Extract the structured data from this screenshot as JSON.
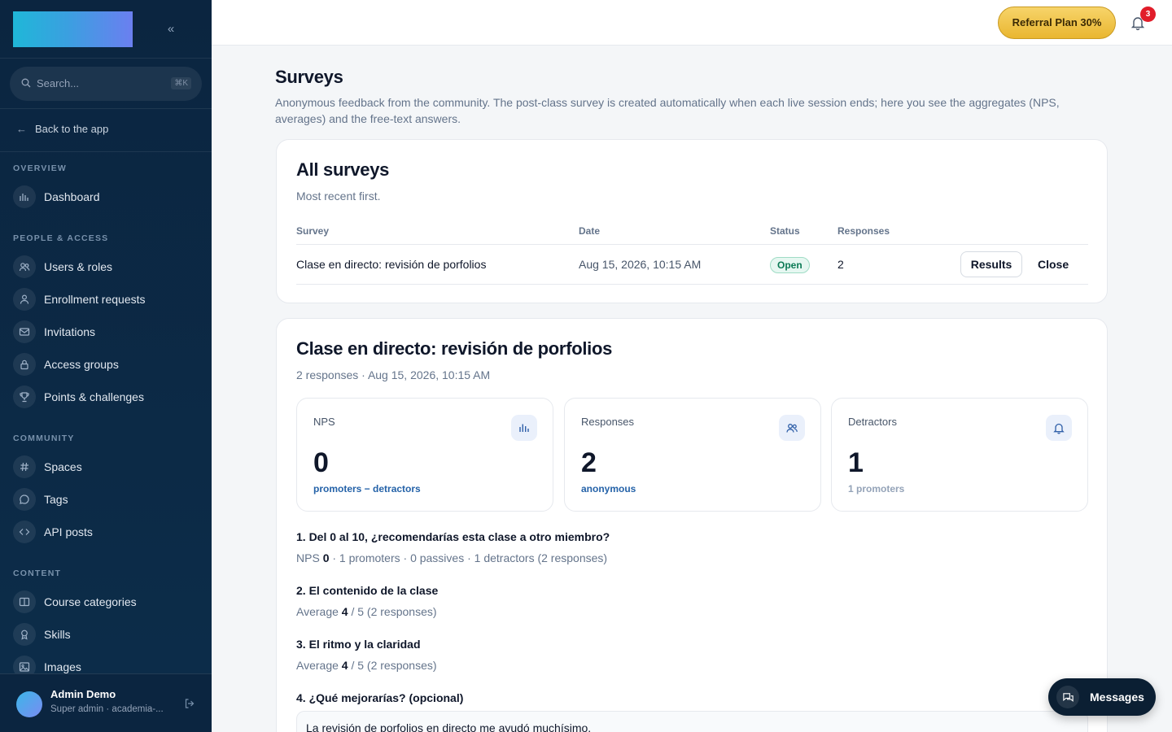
{
  "sidebar": {
    "search_placeholder": "Search...",
    "search_shortcut": "⌘K",
    "back_label": "Back to the app",
    "sections": [
      {
        "label": "OVERVIEW",
        "items": [
          {
            "label": "Dashboard",
            "icon": "bar-chart-icon"
          }
        ]
      },
      {
        "label": "PEOPLE & ACCESS",
        "items": [
          {
            "label": "Users & roles",
            "icon": "users-icon"
          },
          {
            "label": "Enrollment requests",
            "icon": "user-icon"
          },
          {
            "label": "Invitations",
            "icon": "mail-icon"
          },
          {
            "label": "Access groups",
            "icon": "lock-icon"
          },
          {
            "label": "Points & challenges",
            "icon": "trophy-icon"
          }
        ]
      },
      {
        "label": "COMMUNITY",
        "items": [
          {
            "label": "Spaces",
            "icon": "hash-icon"
          },
          {
            "label": "Tags",
            "icon": "chat-bubble-icon"
          },
          {
            "label": "API posts",
            "icon": "code-icon"
          }
        ]
      },
      {
        "label": "CONTENT",
        "items": [
          {
            "label": "Course categories",
            "icon": "book-icon"
          },
          {
            "label": "Skills",
            "icon": "award-icon"
          },
          {
            "label": "Images",
            "icon": "image-icon"
          }
        ]
      }
    ],
    "user": {
      "name": "Admin Demo",
      "role": "Super admin · academia-..."
    }
  },
  "header": {
    "referral_label": "Referral Plan 30%",
    "notification_count": "3"
  },
  "main": {
    "title": "Surveys",
    "description": "Anonymous feedback from the community. The post-class survey is created automatically when each live session ends; here you see the aggregates (NPS, averages) and the free-text answers.",
    "all_surveys": {
      "title": "All surveys",
      "subtitle": "Most recent first.",
      "columns": [
        "Survey",
        "Date",
        "Status",
        "Responses"
      ],
      "rows": [
        {
          "survey": "Clase en directo: revisión de porfolios",
          "date": "Aug 15, 2026, 10:15 AM",
          "status": "Open",
          "responses": "2",
          "results_label": "Results",
          "close_label": "Close"
        }
      ]
    },
    "detail": {
      "title": "Clase en directo: revisión de porfolios",
      "subtitle": "2 responses · Aug 15, 2026, 10:15 AM",
      "stats": [
        {
          "label": "NPS",
          "value": "0",
          "foot": "promoters − detractors",
          "icon": "bar-chart-icon"
        },
        {
          "label": "Responses",
          "value": "2",
          "foot": "anonymous",
          "icon": "users-icon"
        },
        {
          "label": "Detractors",
          "value": "1",
          "foot": "1 promoters",
          "icon": "bell-icon"
        }
      ],
      "questions": [
        {
          "title": "1. Del 0 al 10, ¿recomendarías esta clase a otro miembro?",
          "prefix": "NPS ",
          "value": "0",
          "suffix": " · 1 promoters · 0 passives · 1 detractors (2 responses)"
        },
        {
          "title": "2. El contenido de la clase",
          "prefix": "Average ",
          "value": "4",
          "suffix": " / 5 (2 responses)"
        },
        {
          "title": "3. El ritmo y la claridad",
          "prefix": "Average ",
          "value": "4",
          "suffix": " / 5 (2 responses)"
        },
        {
          "title": "4. ¿Qué mejorarías? (opcional)"
        }
      ],
      "answers": [
        "La revisión de porfolios en directo me ayudó muchísimo."
      ]
    }
  },
  "messages_label": "Messages",
  "colors": {
    "sidebar_bg": "#0b2540",
    "accent": "#2462a8",
    "status_open": "#0b7a55",
    "badge": "#e11d2a",
    "referral": "#e9b630"
  }
}
